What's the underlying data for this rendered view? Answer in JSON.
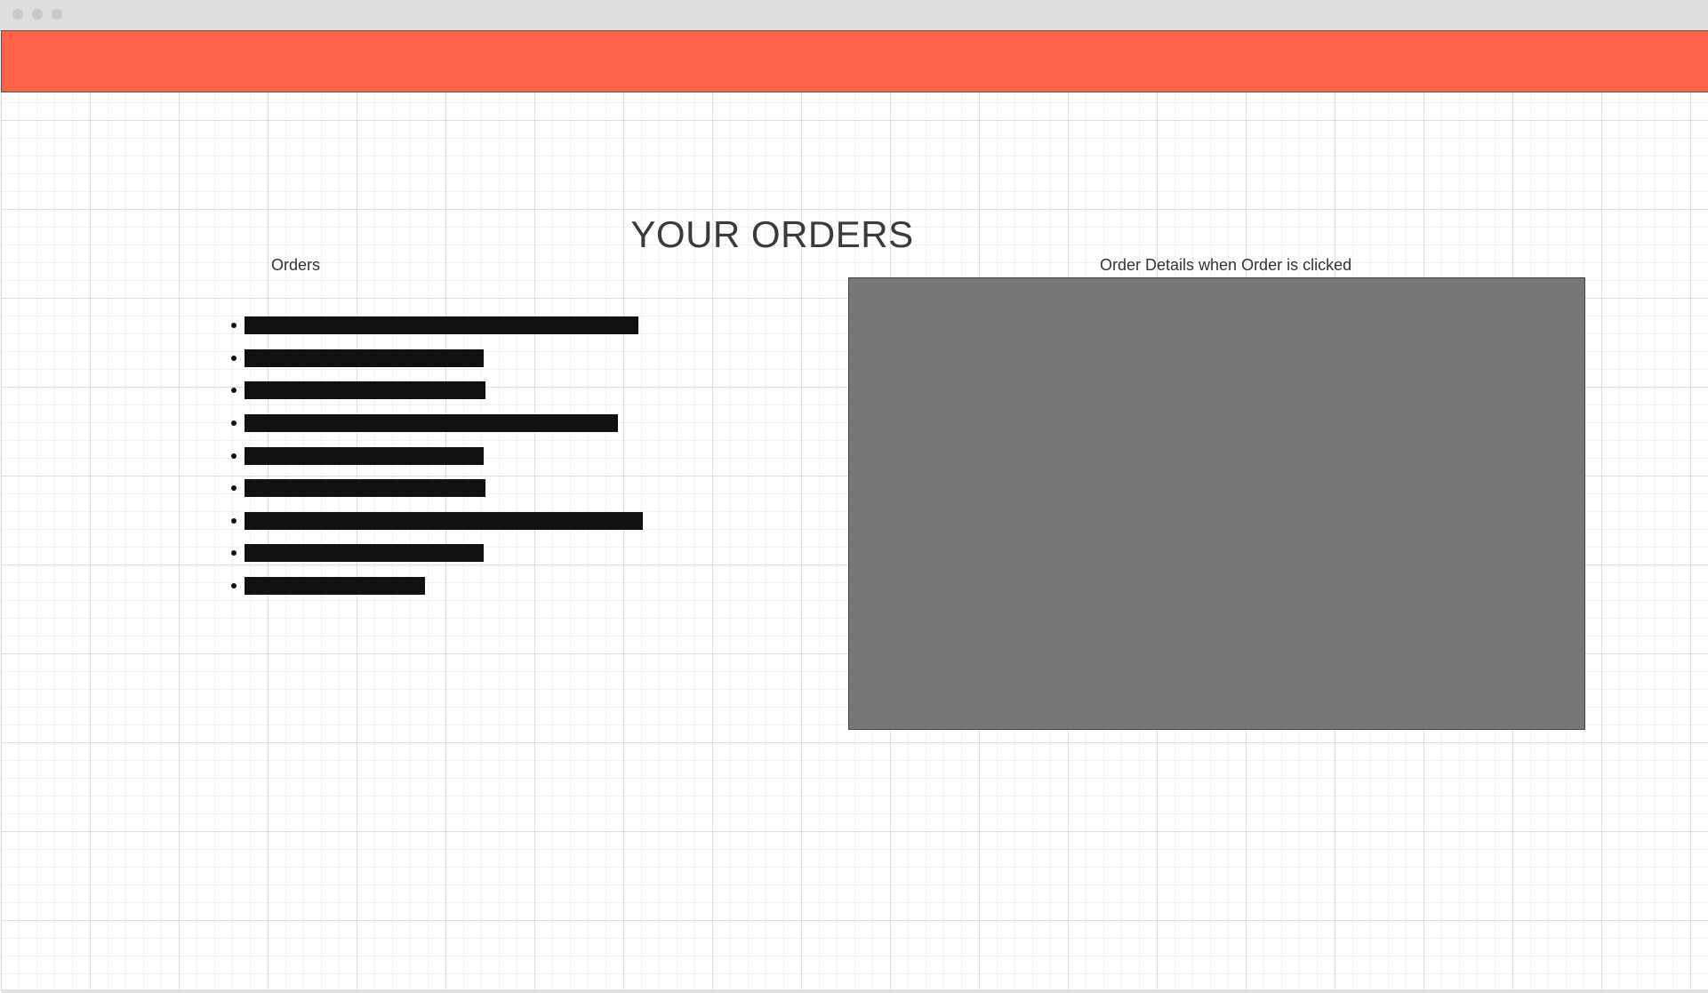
{
  "window": {
    "controls": [
      "close-dot",
      "minimize-dot",
      "zoom-dot"
    ]
  },
  "header": {
    "banner_color": "#ff6347"
  },
  "page": {
    "title": "YOUR ORDERS"
  },
  "orders": {
    "label": "Orders",
    "items": [
      {
        "id": "order-1"
      },
      {
        "id": "order-2"
      },
      {
        "id": "order-3"
      },
      {
        "id": "order-4"
      },
      {
        "id": "order-5"
      },
      {
        "id": "order-6"
      },
      {
        "id": "order-7"
      },
      {
        "id": "order-8"
      },
      {
        "id": "order-9"
      }
    ]
  },
  "details": {
    "label": "Order Details when Order is clicked",
    "panel_color": "#777777"
  }
}
